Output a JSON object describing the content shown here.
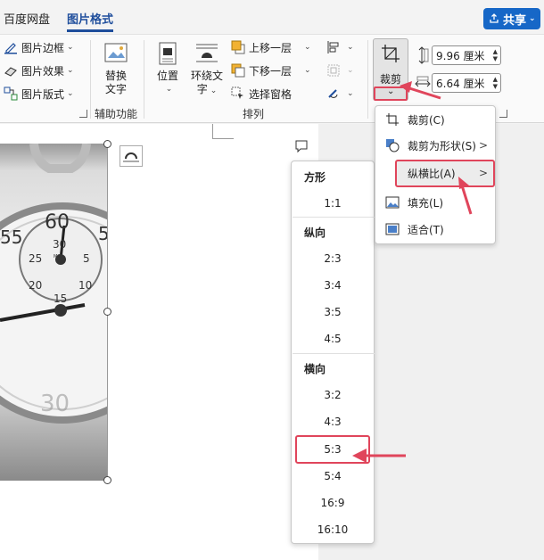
{
  "tabs": [
    {
      "label": "百度网盘"
    },
    {
      "label": "图片格式"
    }
  ],
  "share": {
    "label": "共享"
  },
  "ribbon": {
    "picture_style_items": [
      {
        "label": "图片边框"
      },
      {
        "label": "图片效果"
      },
      {
        "label": "图片版式"
      }
    ],
    "replace_text_label": "替换\n文字",
    "replace_text_line1": "替换",
    "replace_text_line2": "文字",
    "groups": {
      "accessibility": "辅助功能",
      "arrange": "排列"
    },
    "position_label": "位置",
    "wrap_line1": "环绕文",
    "wrap_line2": "字",
    "bring_forward": "上移一层",
    "send_backward": "下移一层",
    "selection_pane": "选择窗格",
    "crop_label": "裁剪",
    "height_value": "9.96 厘米",
    "width_value": "6.64 厘米"
  },
  "crop_menu": {
    "items": [
      {
        "label": "裁剪(C)"
      },
      {
        "label": "裁剪为形状(S)"
      },
      {
        "label": "纵横比(A)"
      },
      {
        "label": "填充(L)"
      },
      {
        "label": "适合(T)"
      }
    ],
    "highlighted": "纵横比(A)"
  },
  "aspect_menu": {
    "square_head": "方形",
    "square_items": [
      "1:1"
    ],
    "portrait_head": "纵向",
    "portrait_items": [
      "2:3",
      "3:4",
      "3:5",
      "4:5"
    ],
    "landscape_head": "横向",
    "landscape_items": [
      "3:2",
      "4:3",
      "5:3",
      "5:4",
      "16:9",
      "16:10"
    ],
    "highlighted": "5:3"
  },
  "photo": {
    "dial_numbers": [
      "60",
      "55",
      "5",
      "30",
      "25",
      "5",
      "20",
      "10",
      "15",
      "MIN",
      "30"
    ]
  },
  "colors": {
    "accent": "#1f4e9c",
    "share_bg": "#1667c7",
    "annotation_red": "#e0455b"
  }
}
